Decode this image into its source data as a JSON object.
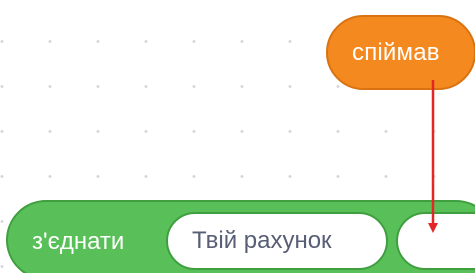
{
  "reporter_block": {
    "label": "спіймав",
    "color": "#f4891f"
  },
  "join_block": {
    "label": "з'єднати",
    "color": "#59c059",
    "input_1_value": "Твій рахунок",
    "input_2_value": ""
  },
  "annotation": {
    "arrow_color": "#e32626"
  }
}
